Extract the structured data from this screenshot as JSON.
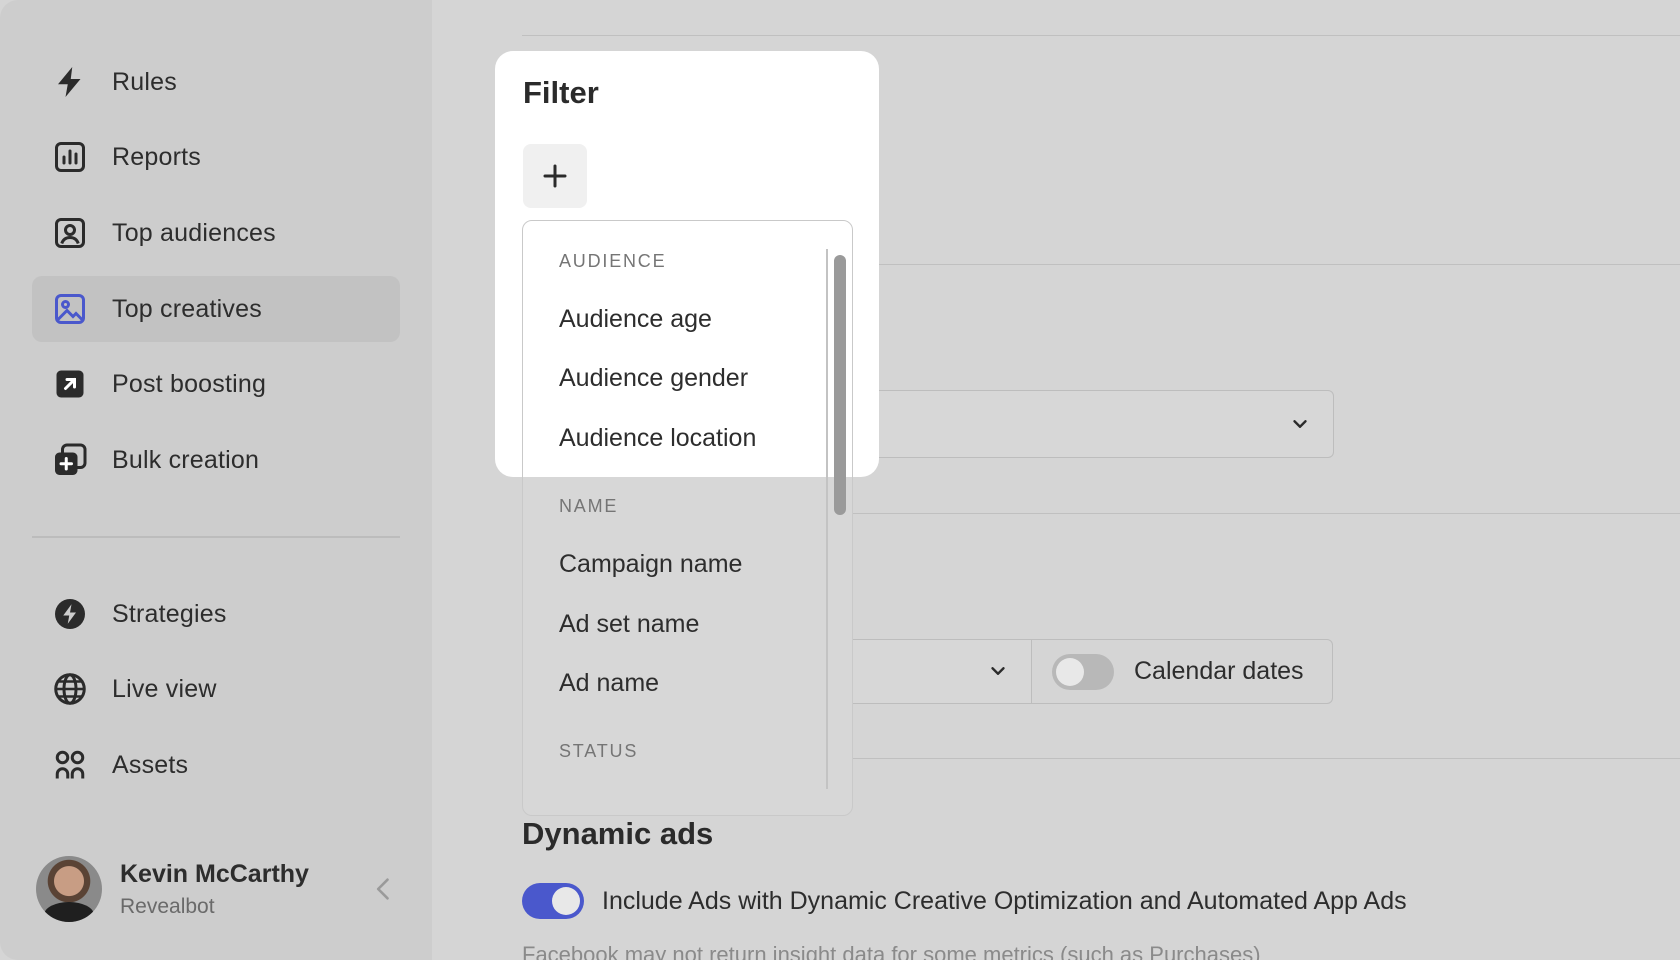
{
  "sidebar": {
    "items": [
      {
        "label": "Rules",
        "icon": "bolt-icon"
      },
      {
        "label": "Reports",
        "icon": "bar-chart-icon"
      },
      {
        "label": "Top audiences",
        "icon": "user-portrait-icon"
      },
      {
        "label": "Top creatives",
        "icon": "image-icon",
        "active": true
      },
      {
        "label": "Post boosting",
        "icon": "arrow-up-right-icon"
      },
      {
        "label": "Bulk creation",
        "icon": "copy-plus-icon"
      }
    ],
    "secondary_items": [
      {
        "label": "Strategies",
        "icon": "bolt-circle-icon"
      },
      {
        "label": "Live view",
        "icon": "globe-icon"
      },
      {
        "label": "Assets",
        "icon": "grid-icon"
      }
    ],
    "profile": {
      "name": "Kevin McCarthy",
      "org": "Revealbot"
    }
  },
  "filter": {
    "title": "Filter",
    "add_label": "+",
    "dropdown": {
      "groups": [
        {
          "label": "AUDIENCE",
          "items": [
            "Audience age",
            "Audience gender",
            "Audience location"
          ]
        },
        {
          "label": "NAME",
          "items": [
            "Campaign name",
            "Ad set name",
            "Ad name"
          ]
        },
        {
          "label": "STATUS",
          "items": []
        }
      ]
    }
  },
  "main": {
    "calendar_toggle_label": "Calendar dates",
    "dynamic_ads": {
      "title": "Dynamic ads",
      "toggle_label": "Include Ads with Dynamic Creative Optimization and Automated App Ads",
      "toggle_on": true,
      "note": "Facebook may not return insight data for some metrics (such as Purchases)"
    }
  },
  "colors": {
    "accent": "#4a58cc",
    "active_icon": "#4a58cc"
  }
}
